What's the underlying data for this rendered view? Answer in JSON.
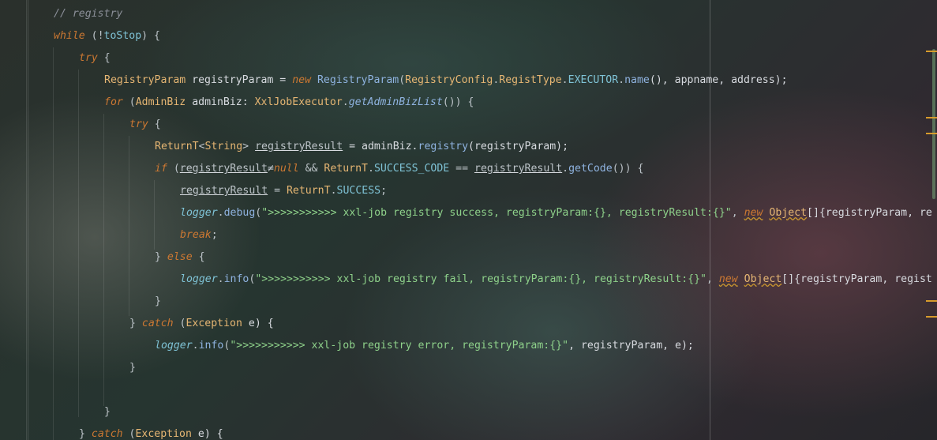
{
  "editor": {
    "lines": [
      {
        "tokens": [
          {
            "t": "// registry",
            "c": "cmt"
          }
        ]
      },
      {
        "tokens": [
          {
            "t": "while",
            "c": "kw"
          },
          {
            "t": " (!",
            "c": "punc"
          },
          {
            "t": "toStop",
            "c": "fld"
          },
          {
            "t": ") {",
            "c": "punc"
          }
        ]
      },
      {
        "tokens": [
          {
            "t": "try",
            "c": "kw"
          },
          {
            "t": " {",
            "c": "punc"
          }
        ]
      },
      {
        "tokens": [
          {
            "t": "RegistryParam",
            "c": "cls"
          },
          {
            "t": " registryParam = ",
            "c": "ident"
          },
          {
            "t": "new",
            "c": "kw"
          },
          {
            "t": " ",
            "c": "punc"
          },
          {
            "t": "RegistryParam",
            "c": "meth"
          },
          {
            "t": "(",
            "c": "punc"
          },
          {
            "t": "RegistryConfig",
            "c": "cls"
          },
          {
            "t": ".",
            "c": "punc"
          },
          {
            "t": "RegistType",
            "c": "cls"
          },
          {
            "t": ".",
            "c": "punc"
          },
          {
            "t": "EXECUTOR",
            "c": "fld"
          },
          {
            "t": ".",
            "c": "punc"
          },
          {
            "t": "name",
            "c": "meth"
          },
          {
            "t": "(), appname, address);",
            "c": "ident"
          }
        ]
      },
      {
        "tokens": [
          {
            "t": "for",
            "c": "kw"
          },
          {
            "t": " (",
            "c": "punc"
          },
          {
            "t": "AdminBiz",
            "c": "cls"
          },
          {
            "t": " adminBiz: ",
            "c": "ident"
          },
          {
            "t": "XxlJobExecutor",
            "c": "cls"
          },
          {
            "t": ".",
            "c": "punc"
          },
          {
            "t": "getAdminBizList",
            "c": "smeth"
          },
          {
            "t": "()) {",
            "c": "punc"
          }
        ]
      },
      {
        "tokens": [
          {
            "t": "try",
            "c": "kw"
          },
          {
            "t": " {",
            "c": "punc"
          }
        ]
      },
      {
        "tokens": [
          {
            "t": "ReturnT",
            "c": "cls"
          },
          {
            "t": "<",
            "c": "punc"
          },
          {
            "t": "String",
            "c": "cls"
          },
          {
            "t": "> ",
            "c": "punc"
          },
          {
            "t": "registryResult",
            "c": "under"
          },
          {
            "t": " = adminBiz.",
            "c": "ident"
          },
          {
            "t": "registry",
            "c": "meth"
          },
          {
            "t": "(registryParam);",
            "c": "ident"
          }
        ]
      },
      {
        "tokens": [
          {
            "t": "if",
            "c": "kw"
          },
          {
            "t": " (",
            "c": "punc"
          },
          {
            "t": "registryResult",
            "c": "under"
          },
          {
            "t": "≠",
            "c": "punc"
          },
          {
            "t": "null",
            "c": "kw"
          },
          {
            "t": " && ",
            "c": "punc"
          },
          {
            "t": "ReturnT",
            "c": "cls"
          },
          {
            "t": ".",
            "c": "punc"
          },
          {
            "t": "SUCCESS_CODE",
            "c": "fld"
          },
          {
            "t": " == ",
            "c": "punc"
          },
          {
            "t": "registryResult",
            "c": "under"
          },
          {
            "t": ".",
            "c": "punc"
          },
          {
            "t": "getCode",
            "c": "meth"
          },
          {
            "t": "()) {",
            "c": "punc"
          }
        ]
      },
      {
        "tokens": [
          {
            "t": "registryResult",
            "c": "under"
          },
          {
            "t": " = ",
            "c": "punc"
          },
          {
            "t": "ReturnT",
            "c": "cls"
          },
          {
            "t": ".",
            "c": "punc"
          },
          {
            "t": "SUCCESS",
            "c": "fld"
          },
          {
            "t": ";",
            "c": "punc"
          }
        ]
      },
      {
        "tokens": [
          {
            "t": "logger",
            "c": "logger"
          },
          {
            "t": ".",
            "c": "punc"
          },
          {
            "t": "debug",
            "c": "meth"
          },
          {
            "t": "(",
            "c": "punc"
          },
          {
            "t": "\">>>>>>>>>>> xxl-job registry success, registryParam:{}, registryResult:{}\"",
            "c": "str"
          },
          {
            "t": ", ",
            "c": "punc"
          },
          {
            "t": "new",
            "c": "kw"
          },
          {
            "t": " ",
            "c": "punc"
          },
          {
            "t": "Object",
            "c": "cls"
          },
          {
            "t": "[]{registryParam, re",
            "c": "ident"
          }
        ]
      },
      {
        "tokens": [
          {
            "t": "break",
            "c": "kw"
          },
          {
            "t": ";",
            "c": "punc"
          }
        ]
      },
      {
        "tokens": [
          {
            "t": "} ",
            "c": "punc"
          },
          {
            "t": "else",
            "c": "kw"
          },
          {
            "t": " {",
            "c": "punc"
          }
        ]
      },
      {
        "tokens": [
          {
            "t": "logger",
            "c": "logger"
          },
          {
            "t": ".",
            "c": "punc"
          },
          {
            "t": "info",
            "c": "meth"
          },
          {
            "t": "(",
            "c": "punc"
          },
          {
            "t": "\">>>>>>>>>>> xxl-job registry fail, registryParam:{}, registryResult:{}\"",
            "c": "str"
          },
          {
            "t": ", ",
            "c": "punc"
          },
          {
            "t": "new",
            "c": "kw"
          },
          {
            "t": " ",
            "c": "punc"
          },
          {
            "t": "Object",
            "c": "cls"
          },
          {
            "t": "[]{registryParam, regist",
            "c": "ident"
          }
        ]
      },
      {
        "tokens": [
          {
            "t": "}",
            "c": "punc"
          }
        ]
      },
      {
        "tokens": [
          {
            "t": "} ",
            "c": "punc"
          },
          {
            "t": "catch",
            "c": "kw"
          },
          {
            "t": " (",
            "c": "punc"
          },
          {
            "t": "Exception",
            "c": "cls"
          },
          {
            "t": " e) {",
            "c": "ident"
          }
        ]
      },
      {
        "tokens": [
          {
            "t": "logger",
            "c": "logger"
          },
          {
            "t": ".",
            "c": "punc"
          },
          {
            "t": "info",
            "c": "meth"
          },
          {
            "t": "(",
            "c": "punc"
          },
          {
            "t": "\">>>>>>>>>>> xxl-job registry error, registryParam:{}\"",
            "c": "str"
          },
          {
            "t": ", registryParam, e);",
            "c": "ident"
          }
        ]
      },
      {
        "tokens": [
          {
            "t": "}",
            "c": "punc"
          }
        ]
      },
      {
        "tokens": []
      },
      {
        "tokens": [
          {
            "t": "}",
            "c": "punc"
          }
        ]
      },
      {
        "tokens": [
          {
            "t": "} ",
            "c": "punc"
          },
          {
            "t": "catch",
            "c": "kw"
          },
          {
            "t": " (",
            "c": "punc"
          },
          {
            "t": "Exception",
            "c": "cls"
          },
          {
            "t": " e) {",
            "c": "ident"
          }
        ]
      }
    ]
  },
  "colors": {
    "keyword": "#cc7832",
    "comment": "#8b8f98",
    "class": "#e6b673",
    "field": "#7fc3d6",
    "string": "#8ed18a",
    "method": "#8fb3e0",
    "scroll_marker": "#d79b2c"
  }
}
